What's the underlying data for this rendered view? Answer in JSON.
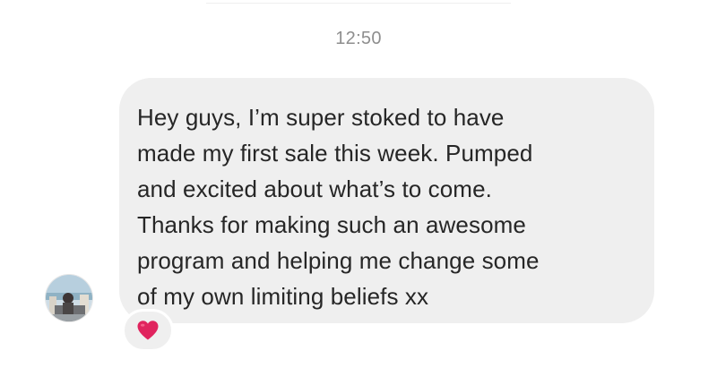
{
  "thread": {
    "timestamp": "12:50"
  },
  "message": {
    "text": "Hey guys, I’m super stoked to have\nmade my first sale this week. Pumped\nand excited about what’s to come.\nThanks for making such an awesome\nprogram and helping me change some\nof my own limiting beliefs xx",
    "reaction_icon": "red-heart-icon"
  },
  "colors": {
    "bubble": "#efefef",
    "text": "#262626",
    "timestamp": "#8e8e8e",
    "heart": "#e0245e"
  }
}
